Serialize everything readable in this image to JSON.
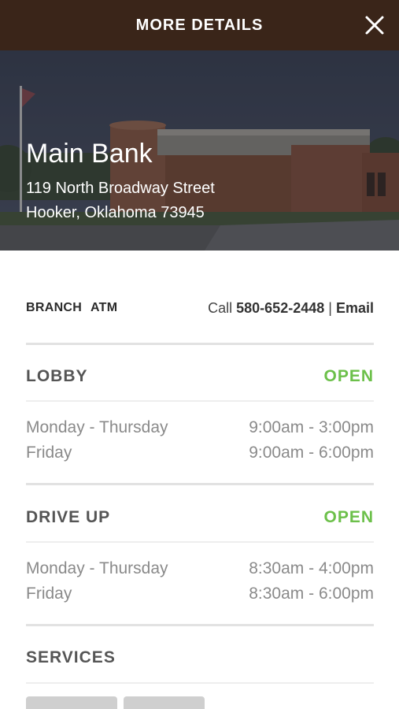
{
  "header": {
    "title": "MORE DETAILS",
    "close_icon": "close-icon",
    "background": "#3a2519"
  },
  "location": {
    "name": "Main Bank",
    "address_line1": "119 North Broadway Street",
    "address_line2": "Hooker, Oklahoma 73945"
  },
  "contact": {
    "tabs": [
      "BRANCH",
      "ATM"
    ],
    "call_prefix": "Call",
    "phone": "580-652-2448",
    "separator": "|",
    "email_label": "Email"
  },
  "lobby": {
    "title": "LOBBY",
    "status": "OPEN",
    "hours": [
      {
        "day": "Monday - Thursday",
        "time": "9:00am - 3:00pm"
      },
      {
        "day": "Friday",
        "time": "9:00am - 6:00pm"
      }
    ]
  },
  "drive_up": {
    "title": "DRIVE UP",
    "status": "OPEN",
    "hours": [
      {
        "day": "Monday - Thursday",
        "time": "8:30am - 4:00pm"
      },
      {
        "day": "Friday",
        "time": "8:30am - 6:00pm"
      }
    ]
  },
  "services": {
    "title": "SERVICES"
  },
  "colors": {
    "open": "#6cc04a",
    "section_title": "#555555",
    "hours_text": "#8a8a8a"
  }
}
